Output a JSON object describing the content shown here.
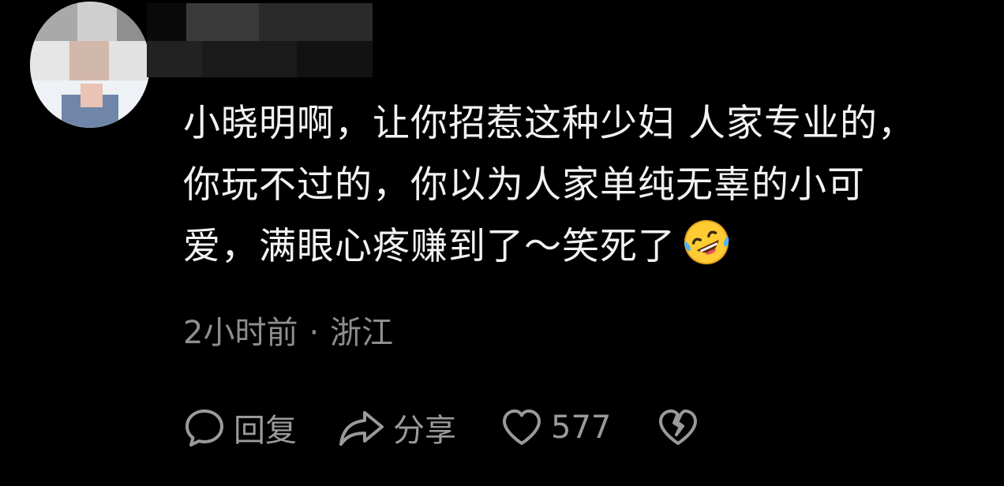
{
  "comment": {
    "lines": [
      "小晓明啊，让你招惹这种少妇 人家专业的，",
      "你玩不过的，你以为人家单纯无辜的小可",
      "爱，满眼心疼赚到了～笑死了"
    ],
    "emoji": "rolling-on-floor-laughing-emoji",
    "time": "2小时前",
    "separator": "·",
    "location": "浙江"
  },
  "actions": {
    "reply_label": "回复",
    "share_label": "分享",
    "like_count": "577"
  },
  "colors": {
    "background": "#000000",
    "text": "#f2f2f2",
    "meta": "#8e8e8e",
    "icon": "#9a9a9a"
  }
}
